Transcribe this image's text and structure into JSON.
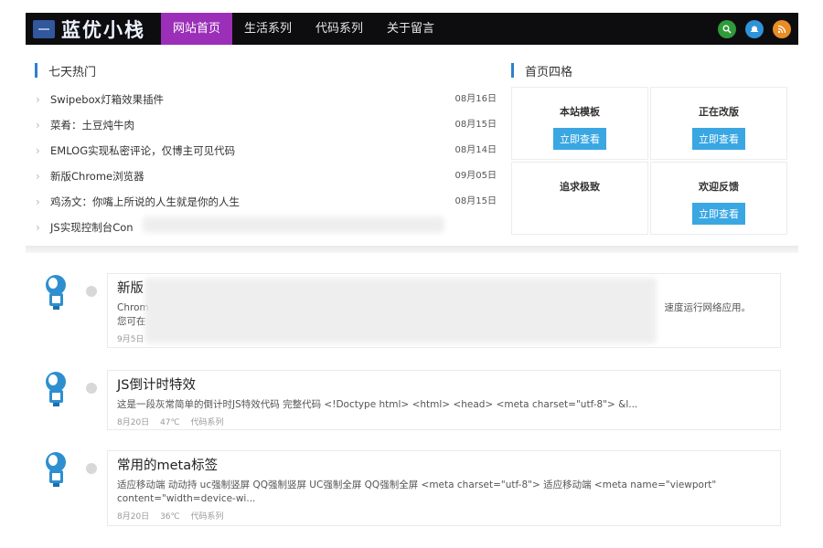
{
  "site": {
    "name": "蓝优小栈"
  },
  "nav": {
    "items": [
      {
        "label": "网站首页",
        "active": true
      },
      {
        "label": "生活系列"
      },
      {
        "label": "代码系列"
      },
      {
        "label": "关于留言"
      }
    ]
  },
  "top_icons": [
    {
      "name": "search-icon",
      "color": "#2f9b3b"
    },
    {
      "name": "notification-icon",
      "color": "#2f93d8"
    },
    {
      "name": "rss-icon",
      "color": "#e88d25"
    }
  ],
  "hot": {
    "title": "七天热门",
    "items": [
      {
        "title": "Swipebox灯箱效果插件",
        "date": "08月16日"
      },
      {
        "title": "菜肴：土豆炖牛肉",
        "date": "08月15日"
      },
      {
        "title": "EMLOG实现私密评论，仅博主可见代码",
        "date": "08月14日"
      },
      {
        "title": "新版Chrome浏览器",
        "date": "09月05日"
      },
      {
        "title": "鸡汤文：你嘴上所说的人生就是你的人生",
        "date": "08月15日"
      },
      {
        "title": "JS实现控制台Con",
        "date": ""
      }
    ]
  },
  "grid": {
    "title": "首页四格",
    "cells": [
      {
        "title": "本站模板",
        "button": "立即查看"
      },
      {
        "title": "正在改版",
        "button": "立即查看"
      },
      {
        "title": "追求极致",
        "button": ""
      },
      {
        "title": "欢迎反馈",
        "button": "立即查看"
      }
    ]
  },
  "posts": [
    {
      "title": "新版",
      "excerpt_1": "Chrom",
      "excerpt_2": "速度运行网络应用。",
      "excerpt_3": "您可在",
      "date": "9月5日",
      "temp": "",
      "category": ""
    },
    {
      "title": "JS倒计时特效",
      "excerpt": "这是一段灰常简单的倒计时JS特效代码 完整代码 <!Doctype html> <html> <head> <meta charset=\"utf-8\"> &l...",
      "date": "8月20日",
      "temp": "47℃",
      "category": "代码系列"
    },
    {
      "title": "常用的meta标签",
      "excerpt": "适应移动端 动动持 uc强制竖屏 QQ强制竖屏 UC强制全屏 QQ强制全屏 <meta charset=\"utf-8\"> 适应移动端 <meta name=\"viewport\" content=\"width=device-wi...",
      "date": "8月20日",
      "temp": "36℃",
      "category": "代码系列"
    }
  ]
}
